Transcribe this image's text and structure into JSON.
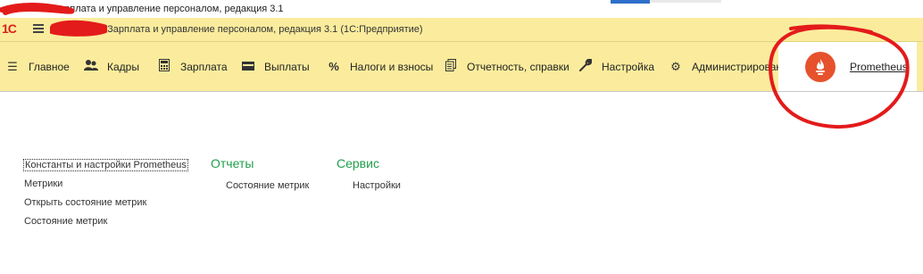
{
  "window": {
    "title": "арплата и управление персоналом, редакция 3.1"
  },
  "header": {
    "logo": "1С",
    "app_title": "/ Зарплата и управление персоналом, редакция 3.1  (1С:Предприятие)",
    "menu_icon": "hamburger-icon"
  },
  "sections": [
    {
      "label": "Главное",
      "icon": "menu-lines-icon"
    },
    {
      "label": "Кадры",
      "icon": "people-icon"
    },
    {
      "label": "Зарплата",
      "icon": "calculator-icon"
    },
    {
      "label": "Выплаты",
      "icon": "wallet-icon"
    },
    {
      "label": "Налоги и взносы",
      "icon": "percent-icon"
    },
    {
      "label": "Отчетность, справки",
      "icon": "documents-icon"
    },
    {
      "label": "Настройка",
      "icon": "wrench-icon"
    },
    {
      "label": "Администрирование",
      "icon": "gear-icon"
    },
    {
      "label": "Prometheus",
      "icon": "prometheus-logo-icon",
      "active": true
    }
  ],
  "content": {
    "main_links": [
      "Константы и настройки Prometheus",
      "Метрики",
      "Открыть состояние метрик",
      "Состояние метрик"
    ],
    "reports": {
      "title": "Отчеты",
      "links": [
        "Состояние метрик"
      ]
    },
    "service": {
      "title": "Сервис",
      "links": [
        "Настройки"
      ]
    }
  },
  "colors": {
    "header_bg": "#fbec9d",
    "group_title": "#1f9e4a",
    "logo_red": "#d8231c",
    "prometheus_orange": "#e6522c",
    "annotation_red": "#e31b1b"
  }
}
